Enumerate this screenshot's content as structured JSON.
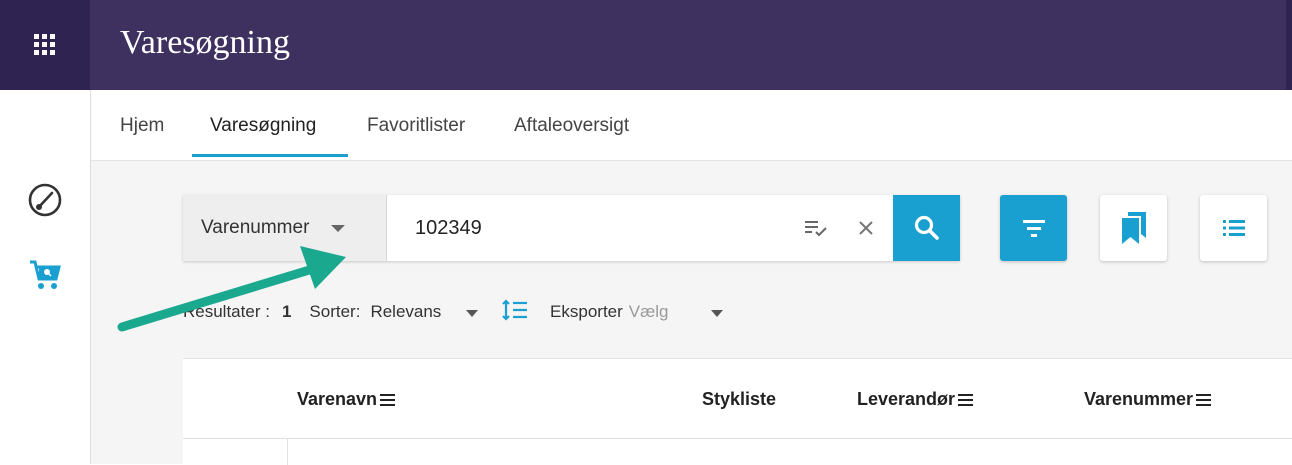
{
  "app": {
    "title": "Varesøgning",
    "menu_icon": "apps-grid-icon"
  },
  "left_rail": {
    "icons": [
      "dashboard-gauge-icon",
      "cart-search-icon"
    ]
  },
  "nav": {
    "tabs": [
      {
        "label": "Hjem",
        "active": false
      },
      {
        "label": "Varesøgning",
        "active": true
      },
      {
        "label": "Favoritlister",
        "active": false
      },
      {
        "label": "Aftaleoversigt",
        "active": false
      }
    ]
  },
  "search": {
    "field_select": "Varenummer",
    "query": "102349",
    "icons": [
      "list-check-icon",
      "clear-icon",
      "search-icon"
    ]
  },
  "toolbar": {
    "icons": [
      "filter-icon",
      "bookmarks-icon",
      "list-view-icon"
    ]
  },
  "results": {
    "label": "Resultater :",
    "count": "1",
    "sort_label": "Sorter:",
    "sort_value": "Relevans",
    "export_label": "Eksporter",
    "export_value": "Vælg"
  },
  "table": {
    "columns": [
      "Varenavn",
      "Stykliste",
      "Leverandør",
      "Varenummer"
    ]
  },
  "colors": {
    "header_bg": "#3e3160",
    "accent": "#1aa0d0",
    "annotation_arrow": "#1aa88e"
  }
}
